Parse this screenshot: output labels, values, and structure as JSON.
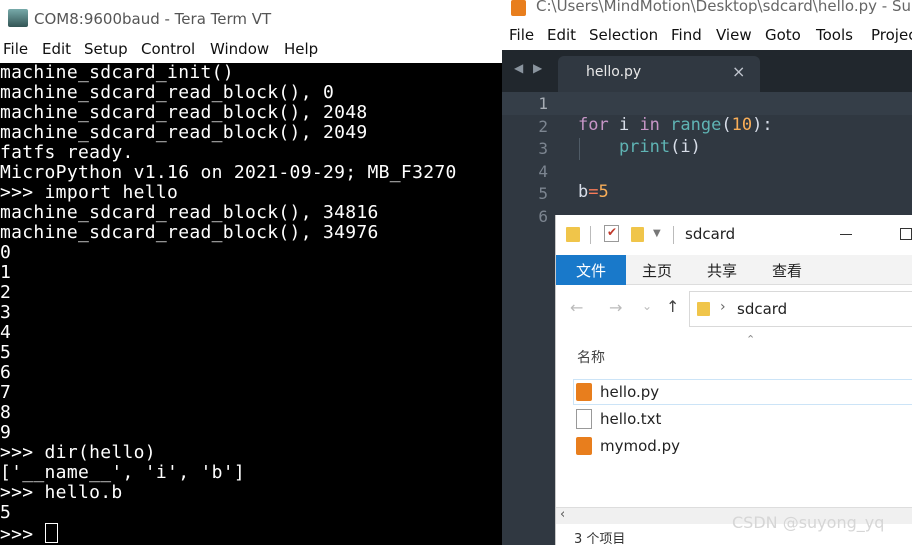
{
  "teraterm": {
    "title": "COM8:9600baud - Tera Term VT",
    "menu": [
      "File",
      "Edit",
      "Setup",
      "Control",
      "Window",
      "Help"
    ],
    "lines": [
      "machine_sdcard_init()",
      "machine_sdcard_read_block(), 0",
      "machine_sdcard_read_block(), 2048",
      "machine_sdcard_read_block(), 2049",
      "fatfs ready.",
      "MicroPython v1.16 on 2021-09-29; MB_F3270",
      ">>> import hello",
      "machine_sdcard_read_block(), 34816",
      "machine_sdcard_read_block(), 34976",
      "0",
      "1",
      "2",
      "3",
      "4",
      "5",
      "6",
      "7",
      "8",
      "9",
      ">>> dir(hello)",
      "['__name__', 'i', 'b']",
      ">>> hello.b",
      "5",
      ">>> "
    ]
  },
  "sublime": {
    "title": "C:\\Users\\MindMotion\\Desktop\\sdcard\\hello.py - Su",
    "menu": [
      "File",
      "Edit",
      "Selection",
      "Find",
      "View",
      "Goto",
      "Tools",
      "Projec"
    ],
    "tab_label": "hello.py",
    "tab_close": "×",
    "gutter": [
      "1",
      "2",
      "3",
      "4",
      "5",
      "6"
    ],
    "code": {
      "kw_for": "for",
      "var_i": " i ",
      "kw_in": "in",
      "fn_range": " range",
      "paren_open": "(",
      "num_10": "10",
      "paren_close_colon": "):",
      "fn_print": "    print",
      "print_args": "(i)",
      "var_b": "b",
      "op_eq": "=",
      "num_5": "5"
    }
  },
  "explorer": {
    "path_title": "sdcard",
    "ribbon_tabs": [
      "文件",
      "主页",
      "共享",
      "查看"
    ],
    "address": "sdcard",
    "column_header": "名称",
    "files": [
      "hello.py",
      "hello.txt",
      "mymod.py"
    ],
    "status": "3 个项目"
  },
  "watermark": "CSDN @suyong_yq",
  "colors": {
    "terminal_bg": "#000000",
    "editor_bg": "#303841",
    "keyword": "#c695c6",
    "function": "#5fb4b4",
    "number": "#f9ae58",
    "operator": "#f97b58",
    "explorer_tab_active": "#1979ca"
  }
}
